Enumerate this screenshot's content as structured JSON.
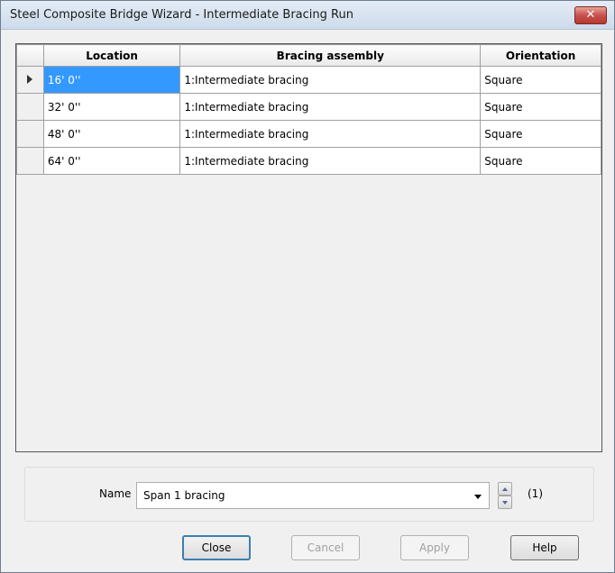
{
  "window": {
    "title": "Steel Composite Bridge Wizard - Intermediate Bracing Run",
    "close_glyph": "✕"
  },
  "grid": {
    "columns": [
      "Location",
      "Bracing assembly",
      "Orientation"
    ],
    "rows": [
      {
        "location": "16' 0''",
        "assembly": "1:Intermediate bracing",
        "orientation": "Square"
      },
      {
        "location": "32' 0''",
        "assembly": "1:Intermediate bracing",
        "orientation": "Square"
      },
      {
        "location": "48' 0''",
        "assembly": "1:Intermediate bracing",
        "orientation": "Square"
      },
      {
        "location": "64' 0''",
        "assembly": "1:Intermediate bracing",
        "orientation": "Square"
      }
    ]
  },
  "name_panel": {
    "label": "Name",
    "value": "Span 1 bracing",
    "count": "(1)"
  },
  "buttons": {
    "close": "Close",
    "cancel": "Cancel",
    "apply": "Apply",
    "help": "Help"
  }
}
